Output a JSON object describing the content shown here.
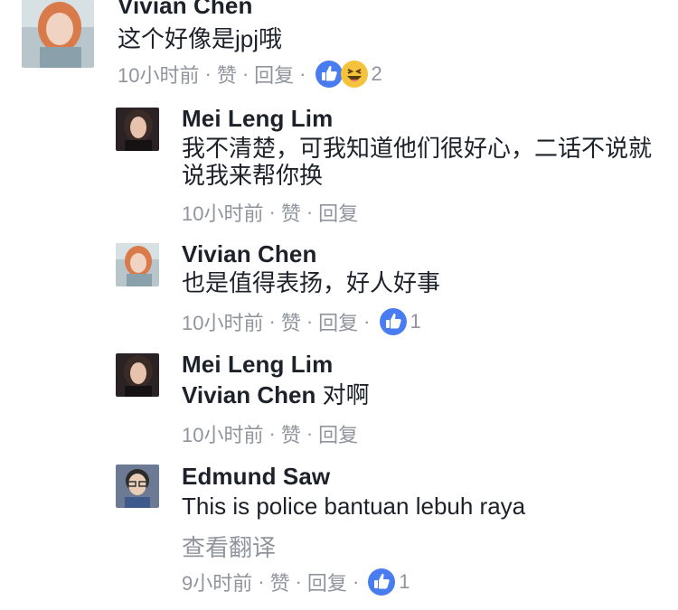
{
  "comments": [
    {
      "name": "Vivian Chen",
      "text": "这个好像是jpj哦",
      "time": "10小时前",
      "like": "赞",
      "reply": "回复",
      "reaction_count": "2"
    },
    {
      "name": "Mei Leng Lim",
      "text": "我不清楚，可我知道他们很好心，二话不说就说我来帮你换",
      "time": "10小时前",
      "like": "赞",
      "reply": "回复"
    },
    {
      "name": "Vivian Chen",
      "text": "也是值得表扬，好人好事",
      "time": "10小时前",
      "like": "赞",
      "reply": "回复",
      "reaction_count": "1"
    },
    {
      "name": "Mei Leng Lim",
      "mention": "Vivian Chen",
      "text": " 对啊",
      "time": "10小时前",
      "like": "赞",
      "reply": "回复"
    },
    {
      "name": "Edmund Saw",
      "text": "This is police bantuan lebuh raya",
      "see_translation": "查看翻译",
      "time": "9小时前",
      "like": "赞",
      "reply": "回复",
      "reaction_count": "1"
    }
  ],
  "separator": "·",
  "colors": {
    "like_blue": "#4a7cf1",
    "haha_yellow": "#f5c33b",
    "meta_gray": "#90949c",
    "text": "#1d2129"
  },
  "icons": [
    "like-reaction-icon",
    "haha-reaction-icon"
  ]
}
